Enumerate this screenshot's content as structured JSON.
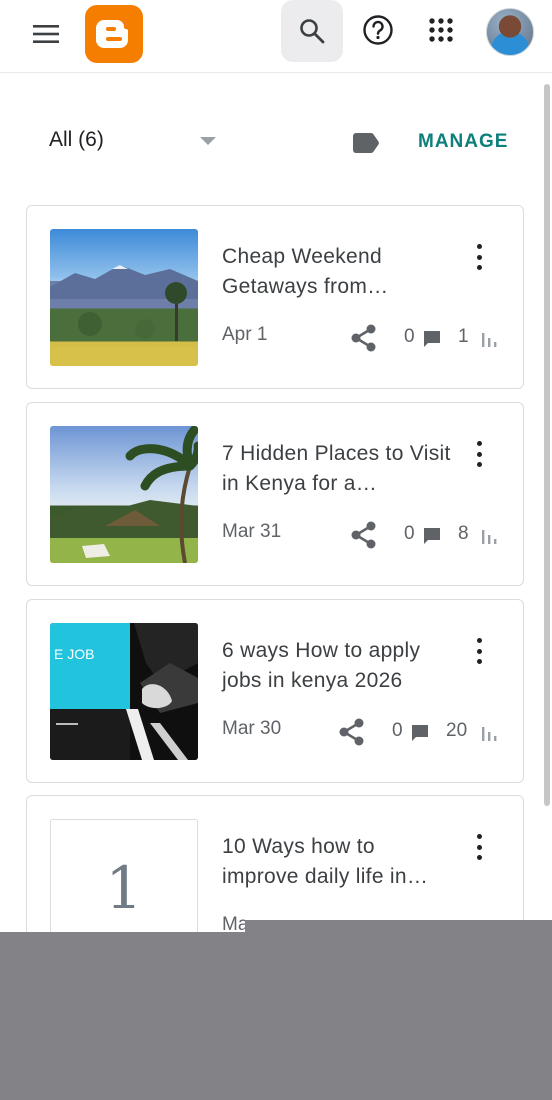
{
  "app": {
    "name": "Blogger",
    "accent_color": "#f57d00",
    "manage_color": "#0e7f7a"
  },
  "header": {
    "menu_icon": "menu-icon",
    "logo_icon": "blogger-logo-icon",
    "search_icon": "search-icon",
    "help_icon": "help-icon",
    "apps_icon": "apps-grid-icon",
    "avatar": "user-avatar"
  },
  "filter": {
    "selected": "All (6)",
    "label_icon": "label-icon",
    "manage_label": "MANAGE"
  },
  "posts": [
    {
      "title": "Cheap Weekend Getaways from…",
      "date": "Apr 1",
      "comments": "0",
      "views": "1"
    },
    {
      "title": "7 Hidden Places to Visit in Kenya for a…",
      "date": "Mar 31",
      "comments": "0",
      "views": "8"
    },
    {
      "title": "6 ways How to apply jobs in kenya 2026",
      "date": "Mar 30",
      "comments": "0",
      "views": "20",
      "thumb_text": "E JOB"
    },
    {
      "title": "10 Ways how to improve daily life in…",
      "date": "Ma",
      "thumb_text": "1"
    }
  ]
}
